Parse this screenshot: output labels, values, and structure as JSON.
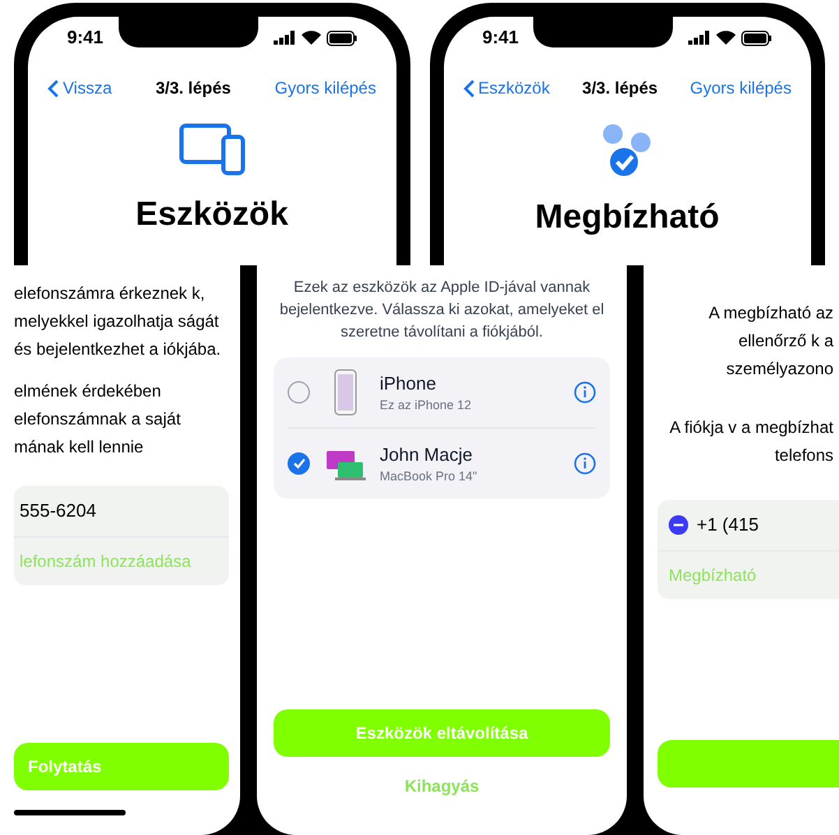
{
  "phones": [
    {
      "time": "9:41",
      "back": "Vissza",
      "step": "3/3. lépés",
      "skip": "Gyors kilépés",
      "kind": "devices",
      "title": "Eszközök"
    },
    {
      "time": "9:41",
      "back": "Eszközök",
      "step": "3/3. lépés",
      "skip": "Gyors kilépés",
      "kind": "trusted",
      "title": "Megbízható"
    }
  ],
  "phone_screen": {
    "paragraphs": [
      "elefonszámra érkeznek k, melyekkel igazolhatja ságát és bejelentkezhet a iókjába.",
      "elmének érdekében elefonszámnak a saját mának kell lennie"
    ],
    "number": "555-6204",
    "add_link": "lefonszám hozzáadása",
    "button": "Folytatás"
  },
  "devices_screen": {
    "description": "Ezek az eszközök az Apple ID-jával vannak bejelentkezve. Válassza ki azokat, amelyeket el szeretne távolítani a fiókjából.",
    "devices": [
      {
        "kind": "phone",
        "name": "iPhone",
        "model": "Ez az iPhone 12",
        "selected": false
      },
      {
        "kind": "laptop",
        "name": "John Macje",
        "model": "MacBook Pro 14\"",
        "selected": true
      }
    ],
    "primary_button": "Eszközök eltávolítása",
    "secondary_button": "Kihagyás"
  },
  "trusted_screen": {
    "paragraphs": [
      "A megbízható az ellenőrző k a személyazono",
      "A fiókja v a megbízhat telefons"
    ],
    "number": "+1 (415",
    "add_link": "Megbízható"
  }
}
